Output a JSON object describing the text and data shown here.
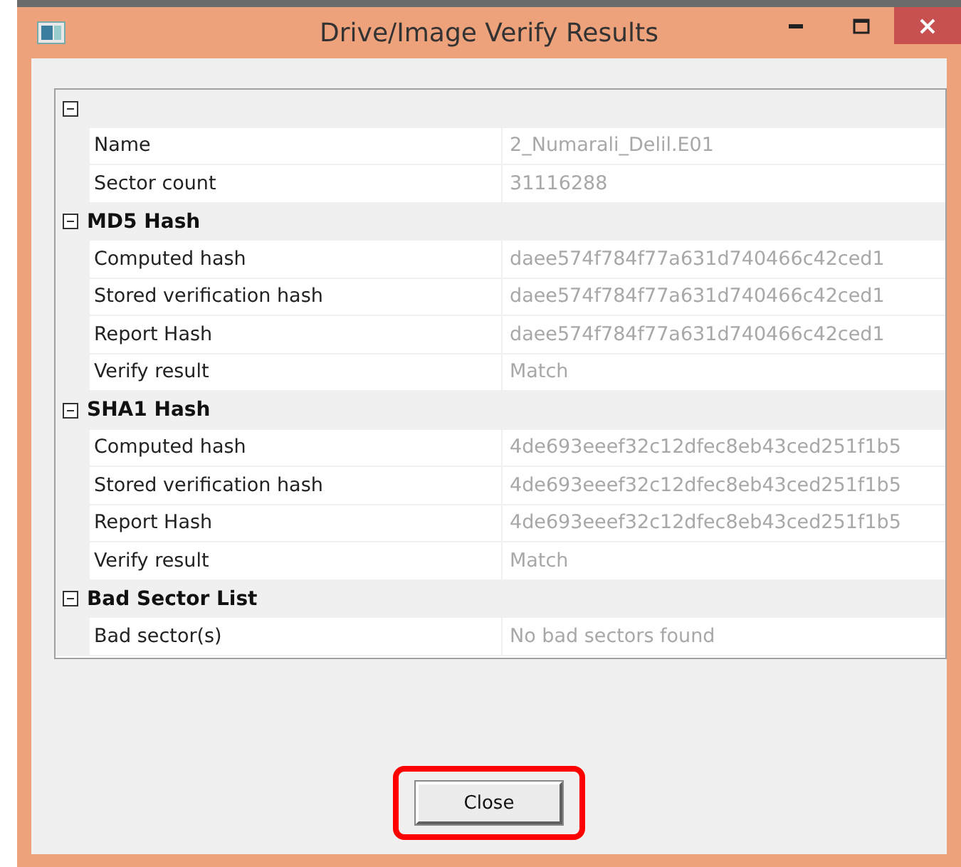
{
  "window": {
    "title": "Drive/Image Verify Results"
  },
  "groups": [
    {
      "expanded": true,
      "rows": [
        {
          "label": "Name",
          "value": "2_Numarali_Delil.E01"
        },
        {
          "label": "Sector count",
          "value": "31116288"
        }
      ]
    },
    {
      "title": "MD5 Hash",
      "expanded": true,
      "rows": [
        {
          "label": "Computed hash",
          "value": "daee574f784f77a631d740466c42ced1"
        },
        {
          "label": "Stored verification hash",
          "value": "daee574f784f77a631d740466c42ced1"
        },
        {
          "label": "Report Hash",
          "value": "daee574f784f77a631d740466c42ced1"
        },
        {
          "label": "Verify result",
          "value": "Match"
        }
      ]
    },
    {
      "title": "SHA1 Hash",
      "expanded": true,
      "rows": [
        {
          "label": "Computed hash",
          "value": "4de693eeef32c12dfec8eb43ced251f1b5"
        },
        {
          "label": "Stored verification hash",
          "value": "4de693eeef32c12dfec8eb43ced251f1b5"
        },
        {
          "label": "Report Hash",
          "value": "4de693eeef32c12dfec8eb43ced251f1b5"
        },
        {
          "label": "Verify result",
          "value": "Match"
        }
      ]
    },
    {
      "title": "Bad Sector List",
      "expanded": true,
      "rows": [
        {
          "label": "Bad sector(s)",
          "value": "No bad sectors found"
        }
      ]
    }
  ],
  "close_button": {
    "label": "Close",
    "highlighted": true
  }
}
